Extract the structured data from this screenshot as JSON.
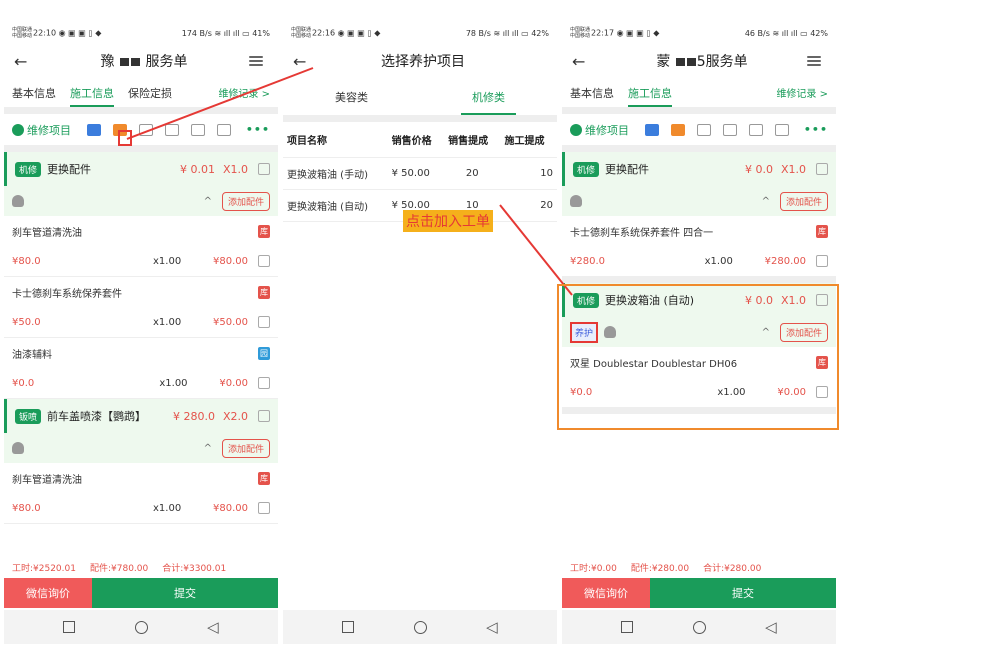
{
  "colors": {
    "green": "#1a9c5a",
    "red": "#e4534b",
    "orange_box": "#f08a2c",
    "annotation_bg": "#f5b01b"
  },
  "phone1": {
    "status_time": "22:10",
    "status_battery": "41%",
    "status_speed": "174 B/s",
    "title_prefix": "豫",
    "title_suffix": "服务单",
    "tabs": [
      "基本信息",
      "施工信息",
      "保险定损"
    ],
    "record_link": "维修记录 >",
    "toolbar_label": "维修项目",
    "services": [
      {
        "badge": "机修",
        "name": "更换配件",
        "price": "¥ 0.01",
        "qty": "X1.0",
        "add": "添加配件",
        "parts": [
          {
            "name": "刹车管道清洗油",
            "price": "¥80.0",
            "qty": "x1.00",
            "total": "¥80.00",
            "tag": "库"
          },
          {
            "name": "卡士德刹车系统保养套件",
            "price": "¥50.0",
            "qty": "x1.00",
            "total": "¥50.00",
            "tag": "库"
          },
          {
            "name": "油漆辅料",
            "price": "¥0.0",
            "qty": "x1.00",
            "total": "¥0.00",
            "tag": "园"
          }
        ]
      },
      {
        "badge": "钣喷",
        "name": "前车盖喷漆【鹦鹉】",
        "price": "¥ 280.0",
        "qty": "X2.0",
        "add": "添加配件",
        "parts": [
          {
            "name": "刹车管道清洗油",
            "price": "¥80.0",
            "qty": "x1.00",
            "total": "¥80.00",
            "tag": "库"
          }
        ]
      }
    ],
    "summary": {
      "labor": "工时:¥2520.01",
      "parts": "配件:¥780.00",
      "total": "合计:¥3300.01"
    },
    "btn_wechat": "微信询价",
    "btn_submit": "提交"
  },
  "phone2": {
    "status_time": "22:16",
    "status_battery": "42%",
    "status_speed": "78 B/s",
    "title": "选择养护项目",
    "type_tabs": [
      "美容类",
      "机修类"
    ],
    "headers": [
      "项目名称",
      "销售价格",
      "销售提成",
      "施工提成"
    ],
    "rows": [
      [
        "更换波箱油 (手动)",
        "¥ 50.00",
        "20",
        "10"
      ],
      [
        "更换波箱油 (自动)",
        "¥ 50.00",
        "10",
        "20"
      ]
    ]
  },
  "phone3": {
    "status_time": "22:17",
    "status_battery": "42%",
    "status_speed": "46 B/s",
    "title_prefix": "蒙",
    "title_suffix": "5服务单",
    "tabs": [
      "基本信息",
      "施工信息"
    ],
    "record_link": "维修记录 >",
    "toolbar_label": "维修项目",
    "service1": {
      "badge": "机修",
      "name": "更换配件",
      "price": "¥ 0.0",
      "qty": "X1.0",
      "add": "添加配件",
      "part": {
        "name": "卡士德刹车系统保养套件 四合一",
        "price": "¥280.0",
        "qty": "x1.00",
        "total": "¥280.00",
        "tag": "库"
      }
    },
    "service2": {
      "badge": "机修",
      "name": "更换波箱油 (自动)",
      "price": "¥ 0.0",
      "qty": "X1.0",
      "add": "添加配件",
      "yang": "养护",
      "part": {
        "name": "双星 Doublestar Doublestar DH06",
        "price": "¥0.0",
        "qty": "x1.00",
        "total": "¥0.00",
        "tag": "库"
      }
    },
    "summary": {
      "labor": "工时:¥0.00",
      "parts": "配件:¥280.00",
      "total": "合计:¥280.00"
    },
    "btn_wechat": "微信询价",
    "btn_submit": "提交"
  },
  "annotation": "点击加入工单"
}
